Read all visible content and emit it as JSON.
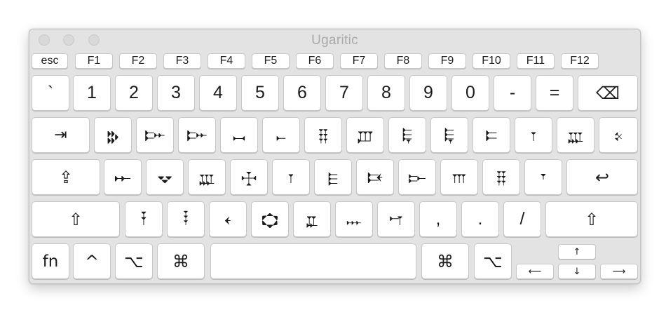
{
  "window": {
    "title": "Ugaritic"
  },
  "keys": {
    "esc": "esc",
    "f1": "F1",
    "f2": "F2",
    "f3": "F3",
    "f4": "F4",
    "f5": "F5",
    "f6": "F6",
    "f7": "F7",
    "f8": "F8",
    "f9": "F9",
    "f10": "F10",
    "f11": "F11",
    "f12": "F12",
    "backtick": "`",
    "n1": "1",
    "n2": "2",
    "n3": "3",
    "n4": "4",
    "n5": "5",
    "n6": "6",
    "n7": "7",
    "n8": "8",
    "n9": "9",
    "n0": "0",
    "minus": "-",
    "equal": "=",
    "delete": "⌫",
    "tab": "⇥",
    "q": "𐎗",
    "w": "𐎆",
    "e": "𐎆",
    "r": "𐎖",
    "t": "𐎚",
    "y": "𐎊",
    "u": "𐎜",
    "i": "𐎛",
    "o": "𐎛",
    "p": "𐎔",
    "bracket_left": "𐎂",
    "bracket_right": "𐎄",
    "backslash": "𐎙",
    "caps": "⇪",
    "a": "𐎀",
    "s": "𐎒",
    "d": "𐎄",
    "f": "𐎈",
    "g": "𐎂",
    "h": "𐎅",
    "j": "𐎑",
    "k": "𐎋",
    "l": "𐎍",
    "semicolon": "𐎊",
    "quote": "𐎟",
    "return": "↩",
    "shift_left": "⇧",
    "z": "𐎇",
    "x": "𐎃",
    "c": "𐎓",
    "v": "𐎘",
    "b": "𐎁",
    "n": "𐎐",
    "m": "𐎎",
    "comma": ",",
    "period": ".",
    "slash": "/",
    "shift_right": "⇧",
    "fn": "fn",
    "control": "^",
    "option_left": "⌥",
    "command_left": "⌘",
    "space": "",
    "command_right": "⌘",
    "option_right": "⌥",
    "arrow_left": "⟵",
    "arrow_up": "↑",
    "arrow_down": "↓",
    "arrow_right": "⟶"
  }
}
